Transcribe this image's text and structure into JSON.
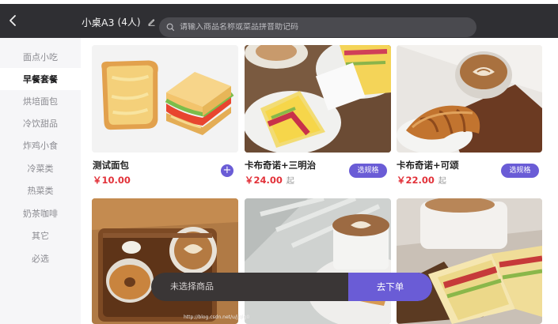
{
  "header": {
    "table_name": "小桌A3",
    "guest_count": "(4人)",
    "search_placeholder": "请输入商品名称或菜品拼音助记码"
  },
  "sidebar": {
    "items": [
      {
        "label": "面点小吃",
        "active": false
      },
      {
        "label": "早餐套餐",
        "active": true
      },
      {
        "label": "烘培面包",
        "active": false
      },
      {
        "label": "冷饮甜品",
        "active": false
      },
      {
        "label": "炸鸡小食",
        "active": false
      },
      {
        "label": "冷菜类",
        "active": false
      },
      {
        "label": "热菜类",
        "active": false
      },
      {
        "label": "奶茶咖啡",
        "active": false
      },
      {
        "label": "其它",
        "active": false
      },
      {
        "label": "必选",
        "active": false
      }
    ]
  },
  "products": [
    {
      "name": "测试面包",
      "price": "￥10.00",
      "from": "",
      "action": "+"
    },
    {
      "name": "卡布奇诺+三明治",
      "price": "￥24.00",
      "from": "起",
      "action": "选规格"
    },
    {
      "name": "卡布奇诺+可颂",
      "price": "￥22.00",
      "from": "起",
      "action": "选规格"
    }
  ],
  "cart": {
    "status": "未选择商品",
    "order_button": "去下单"
  },
  "watermark": "http://blog.csdn.net/u/jiqlg0"
}
